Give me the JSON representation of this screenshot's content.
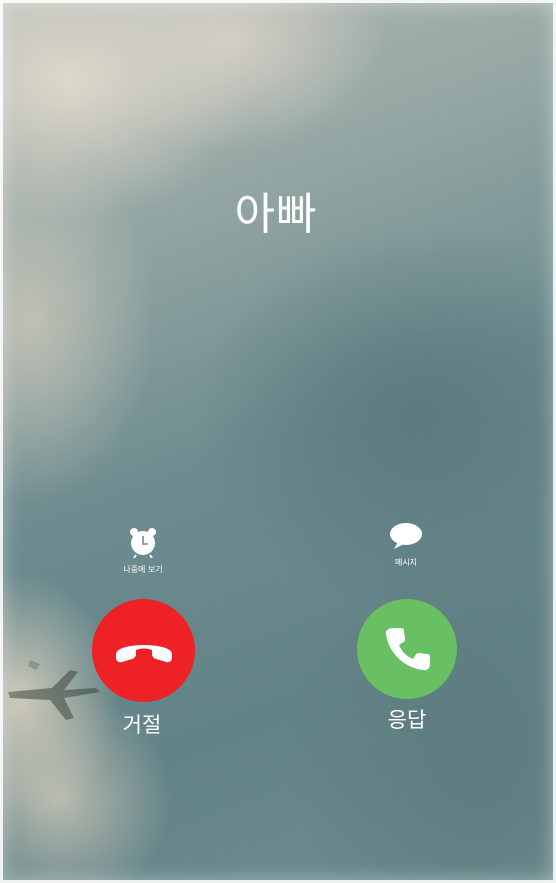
{
  "caller": {
    "name": "아빠"
  },
  "actions": {
    "remind": {
      "label": "나중에 보기",
      "icon": "alarm-clock-icon"
    },
    "message": {
      "label": "메시지",
      "icon": "speech-bubble-icon"
    }
  },
  "call_buttons": {
    "decline": {
      "label": "거절",
      "icon": "phone-hangup-icon",
      "color": "#ee2226"
    },
    "accept": {
      "label": "응답",
      "icon": "phone-icon",
      "color": "#69c062"
    }
  }
}
